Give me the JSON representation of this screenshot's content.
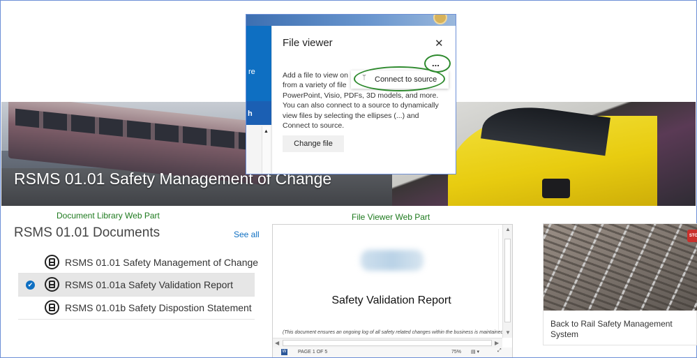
{
  "hero": {
    "title": "RSMS 01.01 Safety Management of Change"
  },
  "annotations": {
    "doclib_label": "Document Library Web Part",
    "fileviewer_label": "File Viewer Web Part"
  },
  "doclib": {
    "title": "RSMS 01.01 Documents",
    "see_all": "See all",
    "items": [
      {
        "label": "RSMS 01.01 Safety Management of Change",
        "selected": false
      },
      {
        "label": "RSMS 01.01a Safety Validation Report",
        "selected": true
      },
      {
        "label": "RSMS 01.01b Safety Dispostion Statement",
        "selected": false
      }
    ],
    "selected_check": "✔"
  },
  "fileviewer": {
    "doc_title": "Safety Validation Report",
    "doc_note": "(This document ensures an ongoing log of all safety related changes within the business is maintained",
    "status": {
      "word_icon": "W",
      "pages": "PAGE 1 OF 5",
      "zoom": "75%",
      "view_icon": "▤ ▾",
      "fit_icon": "⤢"
    },
    "arrows": {
      "up": "▲",
      "down": "▼",
      "left": "◀",
      "right": "▶"
    }
  },
  "card": {
    "caption": "Back to Rail Safety Management System",
    "stop_text": "STO"
  },
  "panel": {
    "title": "File viewer",
    "close": "✕",
    "ellipsis": "...",
    "menu_icon": "ᛘ",
    "menu_item": "Connect to source",
    "left_text_1": "re",
    "left_text_2": "h",
    "left_arrow": "▲",
    "desc_lines": [
      "Add a file to view on",
      "from a variety of file",
      "PowerPoint, Visio, PDFs, 3D models, and more.",
      "You can also connect to a source to dynamically",
      "view files by selecting the ellipses (...) and",
      "Connect to source."
    ],
    "change_file": "Change file"
  },
  "colors": {
    "accent_blue": "#0e6fc2",
    "annotation_green": "#2e8a2e",
    "frame_border": "#6d8fd6"
  }
}
